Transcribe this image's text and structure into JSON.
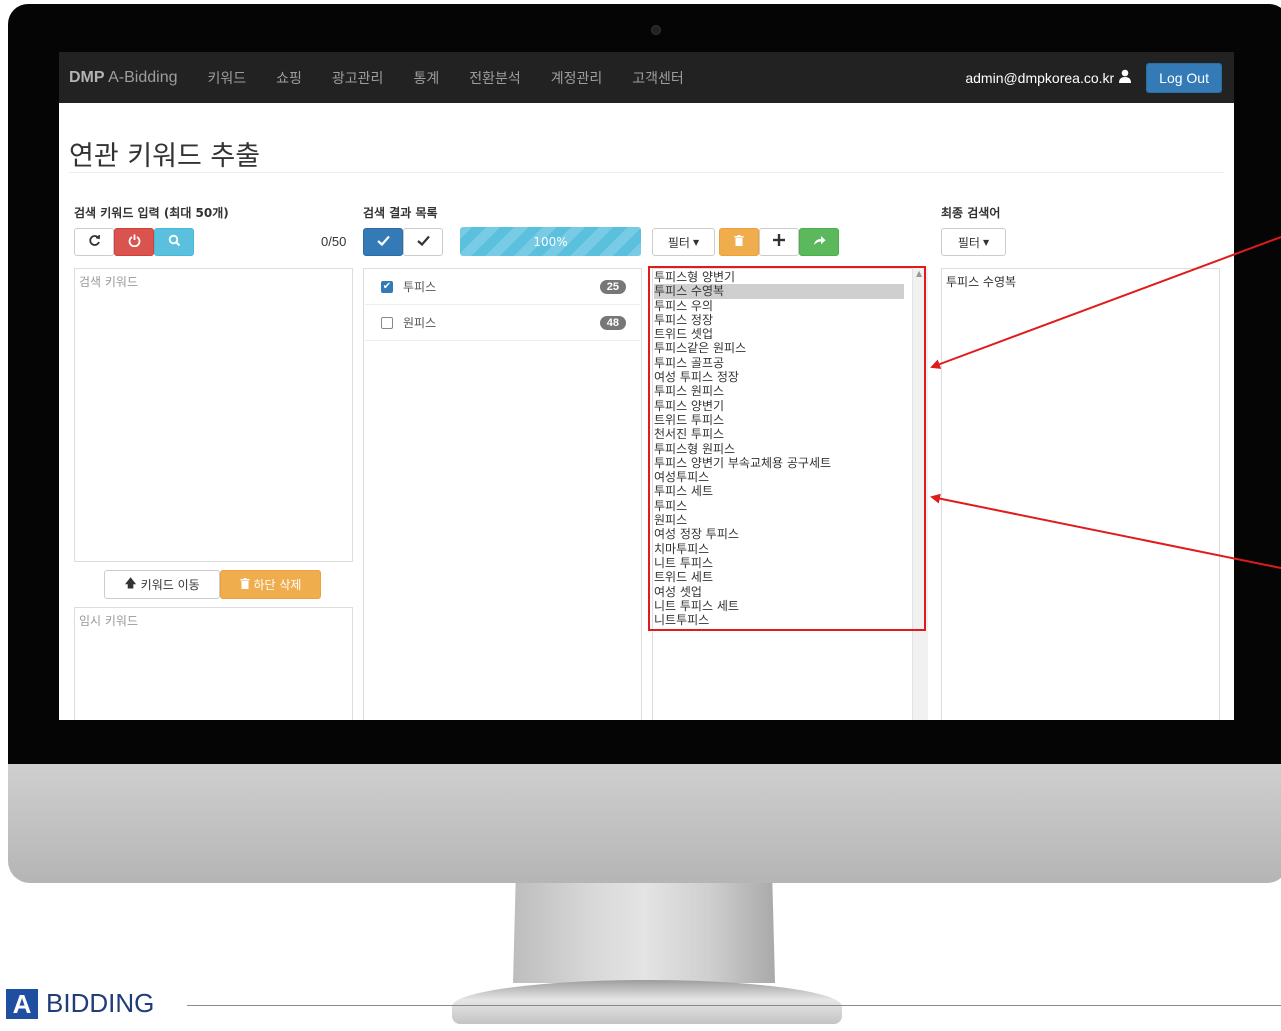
{
  "app": {
    "brand": "DMP",
    "name": " A-Bidding"
  },
  "nav": [
    "키워드",
    "쇼핑",
    "광고관리",
    "통계",
    "전환분석",
    "계정관리",
    "고객센터"
  ],
  "user": {
    "email": "admin@dmpkorea.co.kr",
    "logout_label": "Log Out"
  },
  "page_title": "연관 키워드 추출",
  "input_section": {
    "label": "검색 키워드 입력 (최대 50개)",
    "counter": "0/50",
    "keyword_placeholder": "검색 키워드",
    "move_label": "키워드 이동",
    "delete_label": "하단 삭제",
    "temp_placeholder": "임시 키워드"
  },
  "results_section": {
    "label": "검색 결과 목록",
    "progress": "100%",
    "progress_fraction": 1.0,
    "rows": [
      {
        "label": "투피스",
        "count": "25",
        "checked": true
      },
      {
        "label": "원피스",
        "count": "48",
        "checked": false
      }
    ]
  },
  "filter_label": "필터",
  "keyword_list": [
    "투피스형 양변기",
    "투피스 수영복",
    "투피스 우의",
    "투피스 정장",
    "트위드 셋업",
    "투피스같은 원피스",
    "투피스 골프공",
    "여성 투피스 정장",
    "투피스 원피스",
    "투피스 양변기",
    "트위드 투피스",
    "천서진 투피스",
    "투피스형 원피스",
    "투피스 양변기 부속교체용 공구세트",
    "여성투피스",
    "투피스 세트",
    "투피스",
    "원피스",
    "여성 정장 투피스",
    "치마투피스",
    "니트 투피스",
    "트위드 세트",
    "여성 셋업",
    "니트 투피스 세트",
    "니트투피스"
  ],
  "selected_keyword": "투피스 수영복",
  "final_section": {
    "label": "최종 검색어",
    "items": [
      "투피스 수영복"
    ]
  },
  "footer_brand": {
    "mark": "A",
    "text": "BIDDING"
  },
  "colors": {
    "navbar": "#222222",
    "primary": "#337ab7",
    "info": "#5bc0de",
    "danger": "#d9534f",
    "warning": "#f0ad4e",
    "success": "#5cb85c",
    "annotation": "#e01b1b"
  }
}
